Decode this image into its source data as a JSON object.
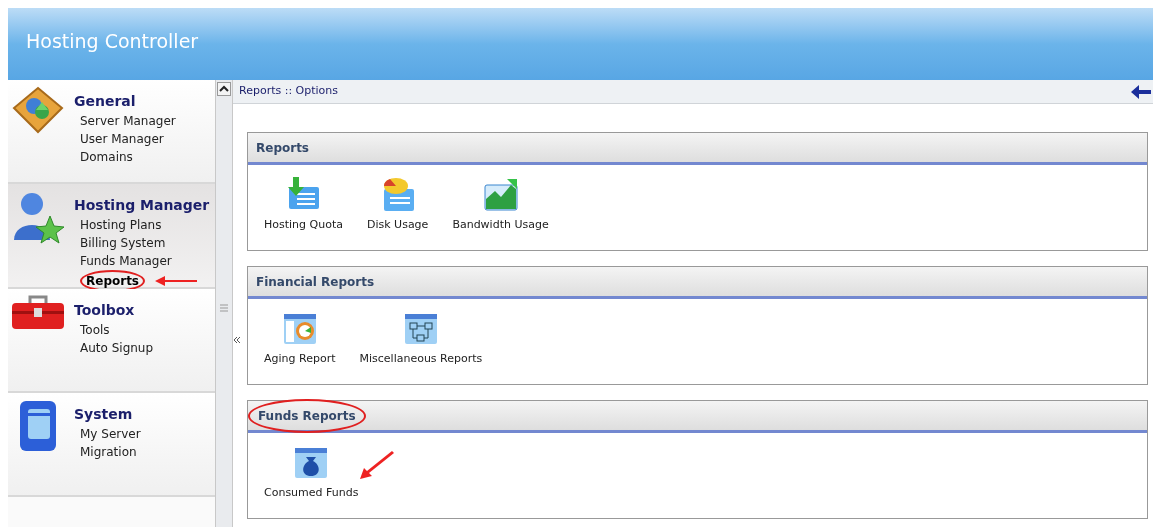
{
  "header": {
    "title": "Hosting Controller"
  },
  "sidebar": {
    "sections": [
      {
        "kind": "general",
        "title": "General",
        "selected": false,
        "items": [
          {
            "label": "Server Manager",
            "selected": false,
            "circled": false,
            "arrow": false
          },
          {
            "label": "User Manager",
            "selected": false,
            "circled": false,
            "arrow": false
          },
          {
            "label": "Domains",
            "selected": false,
            "circled": false,
            "arrow": false
          }
        ]
      },
      {
        "kind": "hosting",
        "title": "Hosting Manager",
        "selected": true,
        "items": [
          {
            "label": "Hosting Plans",
            "selected": false,
            "circled": false,
            "arrow": false
          },
          {
            "label": "Billing System",
            "selected": false,
            "circled": false,
            "arrow": false
          },
          {
            "label": "Funds Manager",
            "selected": false,
            "circled": false,
            "arrow": false
          },
          {
            "label": "Reports",
            "selected": true,
            "circled": true,
            "arrow": true
          }
        ]
      },
      {
        "kind": "toolbox",
        "title": "Toolbox",
        "selected": false,
        "items": [
          {
            "label": "Tools",
            "selected": false,
            "circled": false,
            "arrow": false
          },
          {
            "label": "Auto Signup",
            "selected": false,
            "circled": false,
            "arrow": false
          }
        ]
      },
      {
        "kind": "system",
        "title": "System",
        "selected": false,
        "items": [
          {
            "label": "My Server",
            "selected": false,
            "circled": false,
            "arrow": false
          },
          {
            "label": "Migration",
            "selected": false,
            "circled": false,
            "arrow": false
          }
        ]
      }
    ]
  },
  "breadcrumb": "Reports :: Options",
  "panels": [
    {
      "title": "Reports",
      "circled": false,
      "items": [
        {
          "kind": "quota",
          "label": "Hosting Quota",
          "arrow": false
        },
        {
          "kind": "disk",
          "label": "Disk Usage",
          "arrow": false
        },
        {
          "kind": "bandwidth",
          "label": "Bandwidth Usage",
          "arrow": false
        }
      ]
    },
    {
      "title": "Financial Reports",
      "circled": false,
      "items": [
        {
          "kind": "aging",
          "label": "Aging Report",
          "arrow": false
        },
        {
          "kind": "misc",
          "label": "Miscellaneous Reports",
          "arrow": false
        }
      ]
    },
    {
      "title": "Funds Reports",
      "circled": true,
      "items": [
        {
          "kind": "funds",
          "label": "Consumed Funds",
          "arrow": true
        }
      ]
    }
  ]
}
